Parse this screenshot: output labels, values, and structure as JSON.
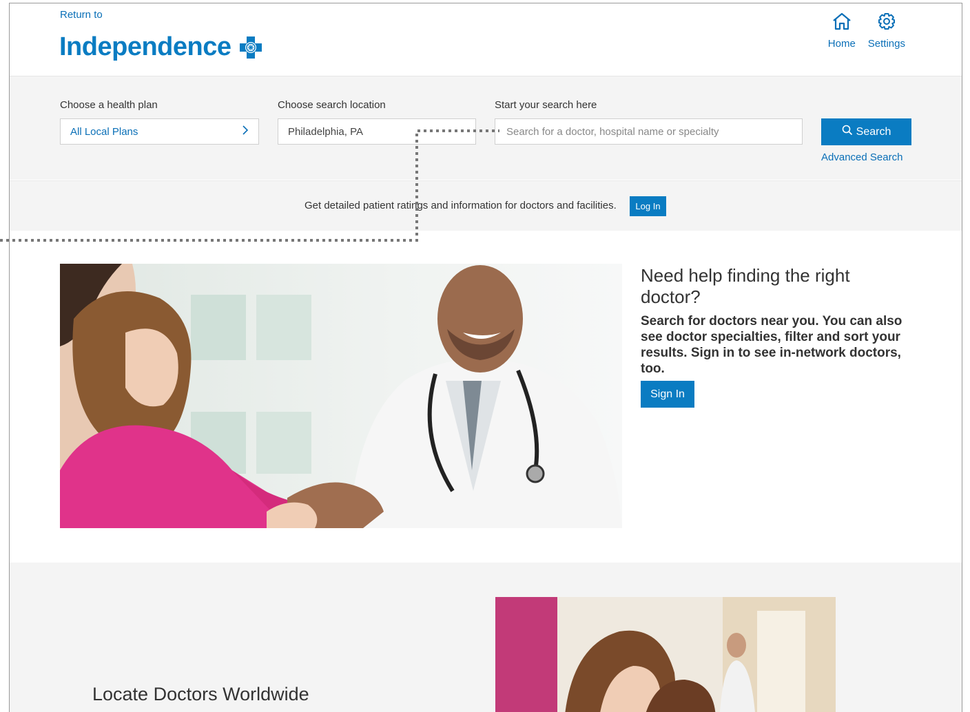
{
  "header": {
    "return_to": "Return to",
    "brand": "Independence",
    "nav": [
      {
        "label": "Home",
        "icon": "home-icon"
      },
      {
        "label": "Settings",
        "icon": "gear-icon"
      }
    ]
  },
  "search": {
    "plan_label": "Choose a health plan",
    "plan_value": "All Local Plans",
    "location_label": "Choose search location",
    "location_value": "Philadelphia, PA",
    "query_label": "Start your search here",
    "query_placeholder": "Search for a doctor, hospital name or specialty",
    "search_button": "Search",
    "advanced_link": "Advanced Search"
  },
  "ratings": {
    "text": "Get detailed patient ratings and information for doctors and facilities.",
    "login_button": "Log In"
  },
  "hero": {
    "title": "Need help finding the right doctor?",
    "description": "Search for doctors near you. You can also see doctor specialties, filter and sort your results. Sign in to see in-network doctors, too.",
    "signin_button": "Sign In"
  },
  "worldwide": {
    "title": "Locate Doctors Worldwide"
  },
  "colors": {
    "brand_blue": "#0a7cc2",
    "link_blue": "#0a6fb7",
    "band_gray": "#f4f4f4"
  }
}
